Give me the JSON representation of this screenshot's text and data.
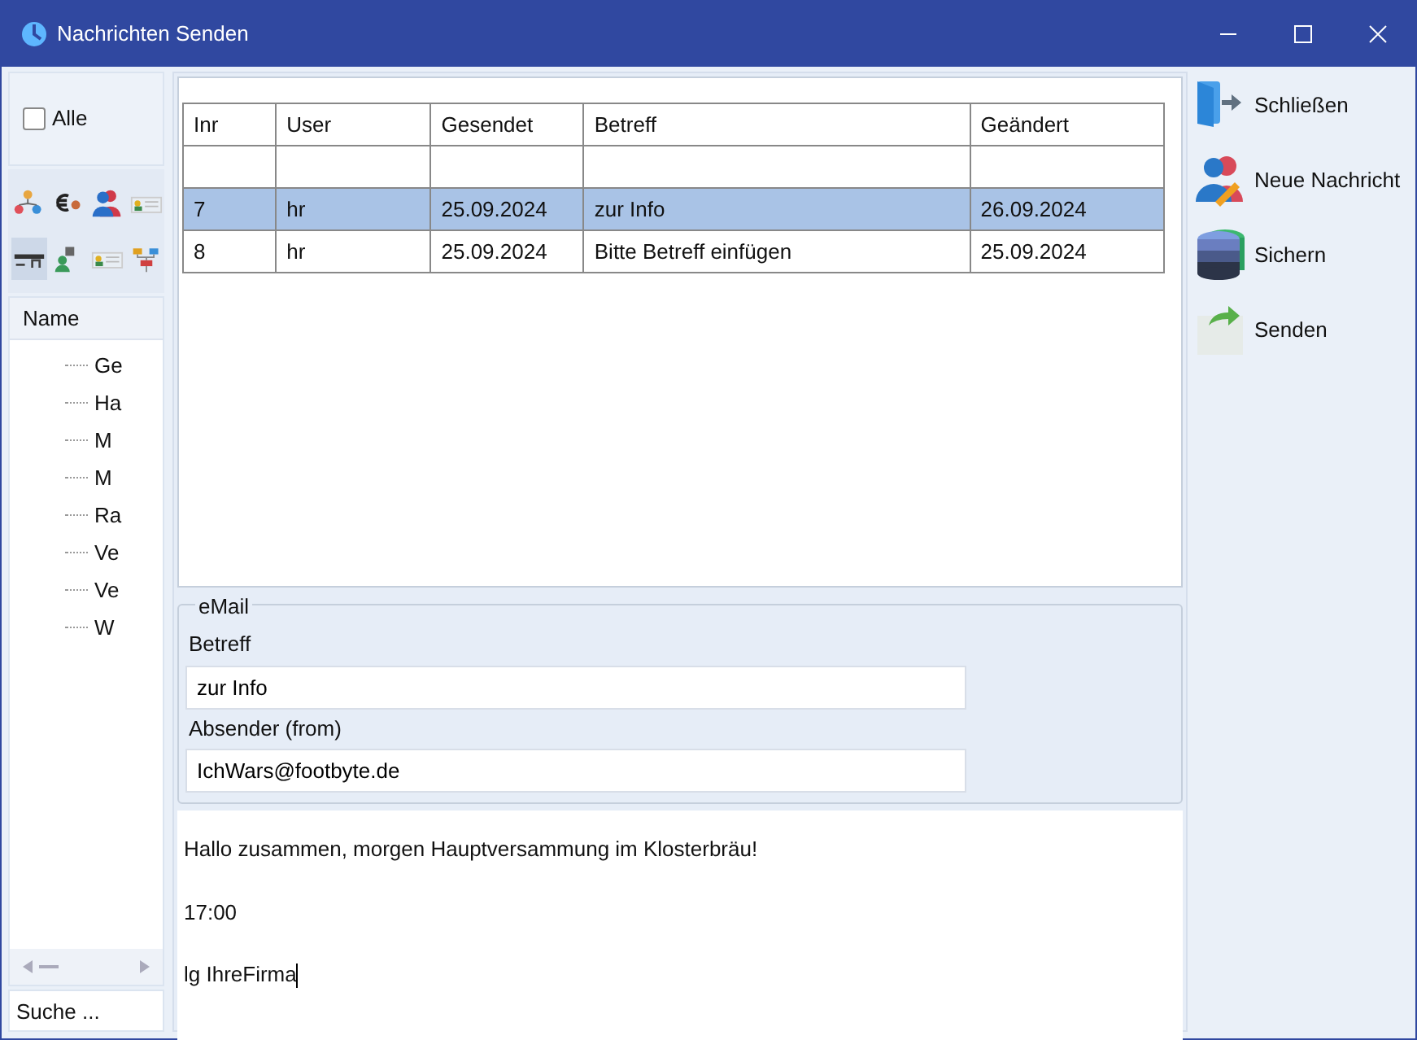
{
  "window": {
    "title": "Nachrichten Senden"
  },
  "sidebar": {
    "select_all": {
      "label": "Alle",
      "checked": false
    },
    "toolbar": [
      {
        "kind": "network",
        "selected": false
      },
      {
        "kind": "euro",
        "selected": false
      },
      {
        "kind": "people",
        "selected": false
      },
      {
        "kind": "card",
        "selected": false
      },
      {
        "kind": "bar",
        "selected": true
      },
      {
        "kind": "person",
        "selected": false
      },
      {
        "kind": "card",
        "selected": false
      },
      {
        "kind": "chart",
        "selected": false
      }
    ],
    "column": "Name",
    "items": [
      {
        "label": "Ge"
      },
      {
        "label": "Ha"
      },
      {
        "label": "M"
      },
      {
        "label": "M"
      },
      {
        "label": "Ra"
      },
      {
        "label": "Ve"
      },
      {
        "label": "Ve"
      },
      {
        "label": "W"
      }
    ],
    "search": {
      "placeholder": "Suche ..."
    }
  },
  "table": {
    "columns": [
      "Inr",
      "User",
      "Gesendet",
      "Betreff",
      "Geändert"
    ],
    "rows": [
      {
        "kind": "blank",
        "selected": false
      },
      {
        "kind": "data",
        "cells": [
          "7",
          "hr",
          "25.09.2024",
          "zur Info",
          "26.09.2024"
        ],
        "selected": true
      },
      {
        "kind": "data",
        "cells": [
          "8",
          "hr",
          "25.09.2024",
          "Bitte Betreff einfügen",
          "25.09.2024"
        ],
        "selected": false
      }
    ]
  },
  "email": {
    "legend": "eMail",
    "fields": [
      {
        "label": "Betreff",
        "value": "zur Info"
      },
      {
        "label": "Absender (from)",
        "value": "IchWars@footbyte.de"
      }
    ]
  },
  "message": {
    "lines": [
      "Hallo zusammen, morgen Hauptversammung im Klosterbräu!",
      "17:00",
      "lg IhreFirma"
    ]
  },
  "actions": [
    {
      "kind": "close",
      "label": "Schließen"
    },
    {
      "kind": "new",
      "label": "Neue Nachricht"
    },
    {
      "kind": "save",
      "label": "Sichern"
    },
    {
      "kind": "send",
      "label": "Senden"
    }
  ]
}
